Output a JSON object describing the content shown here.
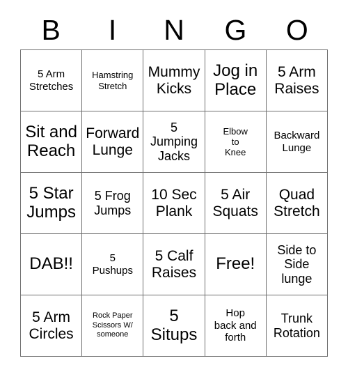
{
  "card": {
    "title": "BINGO",
    "header_letters": [
      "B",
      "I",
      "N",
      "G",
      "O"
    ],
    "grid_size": "5x5",
    "colors": {
      "background": "#ffffff",
      "text": "#000000",
      "border": "#6f6f6f"
    },
    "rows": [
      [
        {
          "text": "5 Arm\nStretches",
          "size": "md"
        },
        {
          "text": "Hamstring\nStretch",
          "size": "sm"
        },
        {
          "text": "Mummy\nKicks",
          "size": "xl"
        },
        {
          "text": "Jog in\nPlace",
          "size": "xxl"
        },
        {
          "text": "5 Arm\nRaises",
          "size": "xl"
        }
      ],
      [
        {
          "text": "Sit and\nReach",
          "size": "xxl"
        },
        {
          "text": "Forward\nLunge",
          "size": "xl"
        },
        {
          "text": "5\nJumping\nJacks",
          "size": "lg"
        },
        {
          "text": "Elbow\nto\nKnee",
          "size": "sm"
        },
        {
          "text": "Backward\nLunge",
          "size": "md"
        }
      ],
      [
        {
          "text": "5 Star\nJumps",
          "size": "xxl"
        },
        {
          "text": "5 Frog\nJumps",
          "size": "lg"
        },
        {
          "text": "10 Sec\nPlank",
          "size": "xl"
        },
        {
          "text": "5 Air\nSquats",
          "size": "xl"
        },
        {
          "text": "Quad\nStretch",
          "size": "xl"
        }
      ],
      [
        {
          "text": "DAB!!",
          "size": "xxl"
        },
        {
          "text": "5\nPushups",
          "size": "md"
        },
        {
          "text": "5 Calf\nRaises",
          "size": "xl"
        },
        {
          "text": "Free!",
          "size": "xxl"
        },
        {
          "text": "Side to\nSide\nlunge",
          "size": "lg"
        }
      ],
      [
        {
          "text": "5 Arm\nCircles",
          "size": "xl"
        },
        {
          "text": "Rock Paper\nScissors W/\nsomeone",
          "size": "xs"
        },
        {
          "text": "5\nSitups",
          "size": "xxl"
        },
        {
          "text": "Hop\nback and\nforth",
          "size": "md"
        },
        {
          "text": "Trunk\nRotation",
          "size": "lg"
        }
      ]
    ]
  }
}
